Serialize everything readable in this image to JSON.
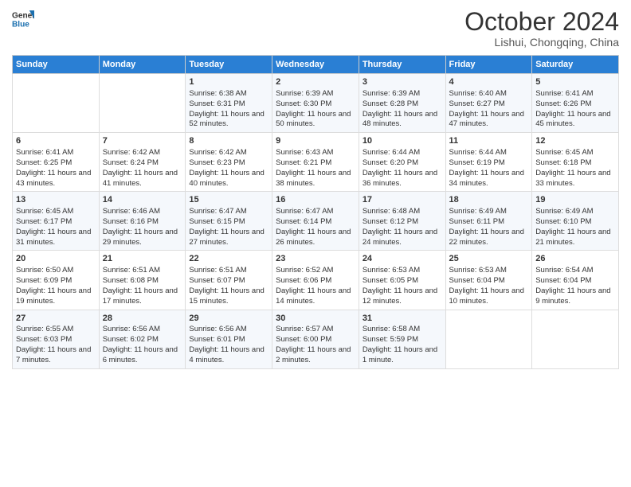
{
  "logo": {
    "line1": "General",
    "line2": "Blue"
  },
  "title": "October 2024",
  "subtitle": "Lishui, Chongqing, China",
  "weekdays": [
    "Sunday",
    "Monday",
    "Tuesday",
    "Wednesday",
    "Thursday",
    "Friday",
    "Saturday"
  ],
  "weeks": [
    [
      {
        "day": "",
        "sunrise": "",
        "sunset": "",
        "daylight": ""
      },
      {
        "day": "",
        "sunrise": "",
        "sunset": "",
        "daylight": ""
      },
      {
        "day": "1",
        "sunrise": "Sunrise: 6:38 AM",
        "sunset": "Sunset: 6:31 PM",
        "daylight": "Daylight: 11 hours and 52 minutes."
      },
      {
        "day": "2",
        "sunrise": "Sunrise: 6:39 AM",
        "sunset": "Sunset: 6:30 PM",
        "daylight": "Daylight: 11 hours and 50 minutes."
      },
      {
        "day": "3",
        "sunrise": "Sunrise: 6:39 AM",
        "sunset": "Sunset: 6:28 PM",
        "daylight": "Daylight: 11 hours and 48 minutes."
      },
      {
        "day": "4",
        "sunrise": "Sunrise: 6:40 AM",
        "sunset": "Sunset: 6:27 PM",
        "daylight": "Daylight: 11 hours and 47 minutes."
      },
      {
        "day": "5",
        "sunrise": "Sunrise: 6:41 AM",
        "sunset": "Sunset: 6:26 PM",
        "daylight": "Daylight: 11 hours and 45 minutes."
      }
    ],
    [
      {
        "day": "6",
        "sunrise": "Sunrise: 6:41 AM",
        "sunset": "Sunset: 6:25 PM",
        "daylight": "Daylight: 11 hours and 43 minutes."
      },
      {
        "day": "7",
        "sunrise": "Sunrise: 6:42 AM",
        "sunset": "Sunset: 6:24 PM",
        "daylight": "Daylight: 11 hours and 41 minutes."
      },
      {
        "day": "8",
        "sunrise": "Sunrise: 6:42 AM",
        "sunset": "Sunset: 6:23 PM",
        "daylight": "Daylight: 11 hours and 40 minutes."
      },
      {
        "day": "9",
        "sunrise": "Sunrise: 6:43 AM",
        "sunset": "Sunset: 6:21 PM",
        "daylight": "Daylight: 11 hours and 38 minutes."
      },
      {
        "day": "10",
        "sunrise": "Sunrise: 6:44 AM",
        "sunset": "Sunset: 6:20 PM",
        "daylight": "Daylight: 11 hours and 36 minutes."
      },
      {
        "day": "11",
        "sunrise": "Sunrise: 6:44 AM",
        "sunset": "Sunset: 6:19 PM",
        "daylight": "Daylight: 11 hours and 34 minutes."
      },
      {
        "day": "12",
        "sunrise": "Sunrise: 6:45 AM",
        "sunset": "Sunset: 6:18 PM",
        "daylight": "Daylight: 11 hours and 33 minutes."
      }
    ],
    [
      {
        "day": "13",
        "sunrise": "Sunrise: 6:45 AM",
        "sunset": "Sunset: 6:17 PM",
        "daylight": "Daylight: 11 hours and 31 minutes."
      },
      {
        "day": "14",
        "sunrise": "Sunrise: 6:46 AM",
        "sunset": "Sunset: 6:16 PM",
        "daylight": "Daylight: 11 hours and 29 minutes."
      },
      {
        "day": "15",
        "sunrise": "Sunrise: 6:47 AM",
        "sunset": "Sunset: 6:15 PM",
        "daylight": "Daylight: 11 hours and 27 minutes."
      },
      {
        "day": "16",
        "sunrise": "Sunrise: 6:47 AM",
        "sunset": "Sunset: 6:14 PM",
        "daylight": "Daylight: 11 hours and 26 minutes."
      },
      {
        "day": "17",
        "sunrise": "Sunrise: 6:48 AM",
        "sunset": "Sunset: 6:12 PM",
        "daylight": "Daylight: 11 hours and 24 minutes."
      },
      {
        "day": "18",
        "sunrise": "Sunrise: 6:49 AM",
        "sunset": "Sunset: 6:11 PM",
        "daylight": "Daylight: 11 hours and 22 minutes."
      },
      {
        "day": "19",
        "sunrise": "Sunrise: 6:49 AM",
        "sunset": "Sunset: 6:10 PM",
        "daylight": "Daylight: 11 hours and 21 minutes."
      }
    ],
    [
      {
        "day": "20",
        "sunrise": "Sunrise: 6:50 AM",
        "sunset": "Sunset: 6:09 PM",
        "daylight": "Daylight: 11 hours and 19 minutes."
      },
      {
        "day": "21",
        "sunrise": "Sunrise: 6:51 AM",
        "sunset": "Sunset: 6:08 PM",
        "daylight": "Daylight: 11 hours and 17 minutes."
      },
      {
        "day": "22",
        "sunrise": "Sunrise: 6:51 AM",
        "sunset": "Sunset: 6:07 PM",
        "daylight": "Daylight: 11 hours and 15 minutes."
      },
      {
        "day": "23",
        "sunrise": "Sunrise: 6:52 AM",
        "sunset": "Sunset: 6:06 PM",
        "daylight": "Daylight: 11 hours and 14 minutes."
      },
      {
        "day": "24",
        "sunrise": "Sunrise: 6:53 AM",
        "sunset": "Sunset: 6:05 PM",
        "daylight": "Daylight: 11 hours and 12 minutes."
      },
      {
        "day": "25",
        "sunrise": "Sunrise: 6:53 AM",
        "sunset": "Sunset: 6:04 PM",
        "daylight": "Daylight: 11 hours and 10 minutes."
      },
      {
        "day": "26",
        "sunrise": "Sunrise: 6:54 AM",
        "sunset": "Sunset: 6:04 PM",
        "daylight": "Daylight: 11 hours and 9 minutes."
      }
    ],
    [
      {
        "day": "27",
        "sunrise": "Sunrise: 6:55 AM",
        "sunset": "Sunset: 6:03 PM",
        "daylight": "Daylight: 11 hours and 7 minutes."
      },
      {
        "day": "28",
        "sunrise": "Sunrise: 6:56 AM",
        "sunset": "Sunset: 6:02 PM",
        "daylight": "Daylight: 11 hours and 6 minutes."
      },
      {
        "day": "29",
        "sunrise": "Sunrise: 6:56 AM",
        "sunset": "Sunset: 6:01 PM",
        "daylight": "Daylight: 11 hours and 4 minutes."
      },
      {
        "day": "30",
        "sunrise": "Sunrise: 6:57 AM",
        "sunset": "Sunset: 6:00 PM",
        "daylight": "Daylight: 11 hours and 2 minutes."
      },
      {
        "day": "31",
        "sunrise": "Sunrise: 6:58 AM",
        "sunset": "Sunset: 5:59 PM",
        "daylight": "Daylight: 11 hours and 1 minute."
      },
      {
        "day": "",
        "sunrise": "",
        "sunset": "",
        "daylight": ""
      },
      {
        "day": "",
        "sunrise": "",
        "sunset": "",
        "daylight": ""
      }
    ]
  ]
}
